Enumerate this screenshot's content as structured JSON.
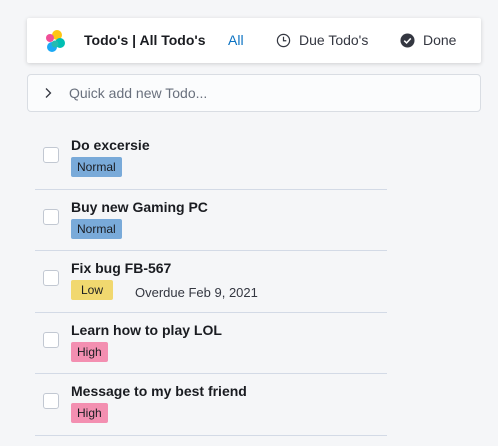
{
  "header": {
    "logo_icon": "elastic-logo-icon",
    "title": "Todo's | All Todo's",
    "tabs": [
      {
        "label": "All",
        "icon": "",
        "active": true
      },
      {
        "label": "Due Todo's",
        "icon": "clock-icon",
        "active": false
      },
      {
        "label": "Done",
        "icon": "check-circle-icon",
        "active": false
      }
    ]
  },
  "quick_add": {
    "placeholder": "Quick add new Todo...",
    "value": "",
    "icon": "chevron-right-icon"
  },
  "todos": [
    {
      "title": "Do excersie",
      "priority": "Normal",
      "due": ""
    },
    {
      "title": "Buy new Gaming PC",
      "priority": "Normal",
      "due": ""
    },
    {
      "title": "Fix bug FB-567",
      "priority": "Low",
      "due": "Overdue Feb 9, 2021"
    },
    {
      "title": "Learn how to play LOL",
      "priority": "High",
      "due": ""
    },
    {
      "title": "Message to my best friend",
      "priority": "High",
      "due": ""
    }
  ],
  "colors": {
    "accent": "#0b72c2",
    "normal": "#79aad9",
    "low": "#f1d86f",
    "high": "#f38fb1"
  }
}
